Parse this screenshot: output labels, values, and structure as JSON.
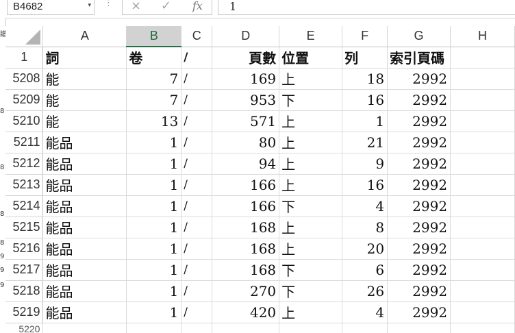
{
  "formula_bar": {
    "name_box": "B4682",
    "name_box_arrow": "▾",
    "dots": "⋮",
    "cancel_icon": "×",
    "enter_icon": "✓",
    "fx_label": "fx",
    "formula_value": "1"
  },
  "left_edge_glyphs": [
    "譜",
    "8",
    "8",
    "8",
    "8",
    "9",
    "9",
    "9"
  ],
  "columns": [
    "A",
    "B",
    "C",
    "D",
    "E",
    "F",
    "G",
    "H"
  ],
  "selected_column": "B",
  "header_row": {
    "row_number": "1",
    "cells": [
      "詞",
      "卷",
      "/",
      "頁數",
      "位置",
      "列",
      "索引頁碼",
      ""
    ]
  },
  "rows": [
    {
      "n": "5208",
      "a": "能",
      "b": "7",
      "c": "/",
      "d": "169",
      "e": "上",
      "f": "18",
      "g": "2992"
    },
    {
      "n": "5209",
      "a": "能",
      "b": "7",
      "c": "/",
      "d": "953",
      "e": "下",
      "f": "16",
      "g": "2992"
    },
    {
      "n": "5210",
      "a": "能",
      "b": "13",
      "c": "/",
      "d": "571",
      "e": "上",
      "f": "1",
      "g": "2992"
    },
    {
      "n": "5211",
      "a": "能品",
      "b": "1",
      "c": "/",
      "d": "80",
      "e": "上",
      "f": "21",
      "g": "2992"
    },
    {
      "n": "5212",
      "a": "能品",
      "b": "1",
      "c": "/",
      "d": "94",
      "e": "上",
      "f": "9",
      "g": "2992"
    },
    {
      "n": "5213",
      "a": "能品",
      "b": "1",
      "c": "/",
      "d": "166",
      "e": "上",
      "f": "16",
      "g": "2992"
    },
    {
      "n": "5214",
      "a": "能品",
      "b": "1",
      "c": "/",
      "d": "166",
      "e": "下",
      "f": "4",
      "g": "2992"
    },
    {
      "n": "5215",
      "a": "能品",
      "b": "1",
      "c": "/",
      "d": "168",
      "e": "上",
      "f": "8",
      "g": "2992"
    },
    {
      "n": "5216",
      "a": "能品",
      "b": "1",
      "c": "/",
      "d": "168",
      "e": "上",
      "f": "20",
      "g": "2992"
    },
    {
      "n": "5217",
      "a": "能品",
      "b": "1",
      "c": "/",
      "d": "168",
      "e": "下",
      "f": "6",
      "g": "2992"
    },
    {
      "n": "5218",
      "a": "能品",
      "b": "1",
      "c": "/",
      "d": "270",
      "e": "下",
      "f": "26",
      "g": "2992"
    },
    {
      "n": "5219",
      "a": "能品",
      "b": "1",
      "c": "/",
      "d": "420",
      "e": "上",
      "f": "4",
      "g": "2992"
    }
  ],
  "partial_row_number": "5220"
}
